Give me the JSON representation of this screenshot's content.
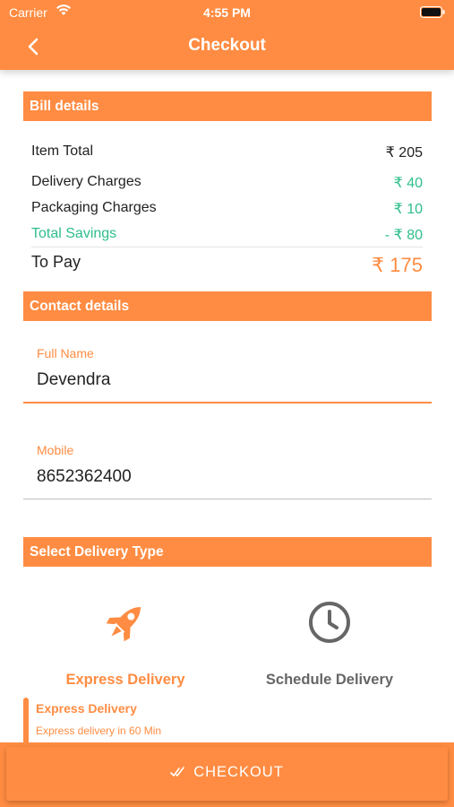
{
  "status_bar": {
    "carrier": "Carrier",
    "time": "4:55 PM"
  },
  "header": {
    "title": "Checkout"
  },
  "bill": {
    "section_title": "Bill details",
    "item_total_label": "Item Total",
    "item_total_value": "₹ 205",
    "delivery_label": "Delivery Charges",
    "delivery_value": "₹ 40",
    "packaging_label": "Packaging Charges",
    "packaging_value": "₹ 10",
    "savings_label": "Total Savings",
    "savings_value": "- ₹ 80",
    "to_pay_label": "To Pay",
    "to_pay_value": "₹ 175"
  },
  "contact": {
    "section_title": "Contact details",
    "name_label": "Full Name",
    "name_value": "Devendra",
    "mobile_label": "Mobile",
    "mobile_value": "8652362400"
  },
  "delivery": {
    "section_title": "Select Delivery Type",
    "express_label": "Express Delivery",
    "schedule_label": "Schedule Delivery",
    "selected_title": "Express Delivery",
    "selected_desc": "Express delivery in 60 Min"
  },
  "footer": {
    "checkout_label": "CHECKOUT"
  },
  "colors": {
    "accent": "#FF8C42",
    "savings": "#2DBE8A",
    "inactive": "#666666"
  },
  "icons": {
    "back": "chevron-left-icon",
    "express": "rocket-icon",
    "schedule": "clock-icon",
    "checkout": "double-check-icon"
  }
}
